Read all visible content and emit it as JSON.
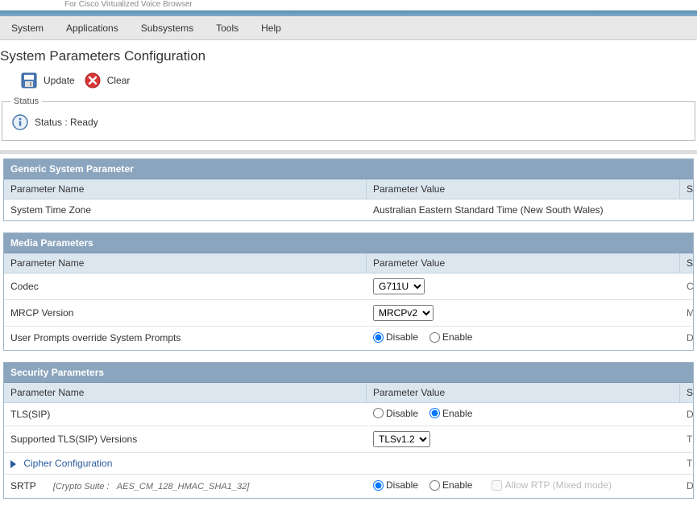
{
  "subtitle": "For Cisco Virtualized Voice Browser",
  "menu": {
    "items": [
      "System",
      "Applications",
      "Subsystems",
      "Tools",
      "Help"
    ]
  },
  "page": {
    "title": "System Parameters Configuration"
  },
  "toolbar": {
    "update_label": "Update",
    "clear_label": "Clear"
  },
  "status": {
    "legend": "Status",
    "text": "Status : Ready"
  },
  "columns": {
    "param_name": "Parameter Name",
    "param_value": "Parameter Value",
    "ext": "S"
  },
  "generic_section": {
    "title": "Generic System Parameter",
    "ext_col": "S",
    "timezone": {
      "name": "System Time Zone",
      "value": "Australian Eastern Standard Time (New South Wales)"
    }
  },
  "media_section": {
    "title": "Media Parameters",
    "ext_col": "S",
    "codec": {
      "name": "Codec",
      "options": [
        "G711U"
      ],
      "selected": "G711U",
      "ext": "C"
    },
    "mrcp": {
      "name": "MRCP Version",
      "options": [
        "MRCPv2"
      ],
      "selected": "MRCPv2",
      "ext": "M"
    },
    "user_prompts": {
      "name": "User Prompts override System Prompts",
      "disable_label": "Disable",
      "enable_label": "Enable",
      "selected": "disable",
      "ext": "D"
    }
  },
  "security_section": {
    "title": "Security Parameters",
    "ext_col": "S",
    "tls_sip": {
      "name": "TLS(SIP)",
      "disable_label": "Disable",
      "enable_label": "Enable",
      "selected": "enable",
      "ext": "D"
    },
    "tls_versions": {
      "name": "Supported TLS(SIP) Versions",
      "options": [
        "TLSv1.2"
      ],
      "selected": "TLSv1.2",
      "ext": "T"
    },
    "cipher": {
      "label": "Cipher Configuration",
      "ext": "T"
    },
    "srtp": {
      "name": "SRTP",
      "crypto_label": "[Crypto Suite :",
      "crypto_value": "AES_CM_128_HMAC_SHA1_32]",
      "disable_label": "Disable",
      "enable_label": "Enable",
      "allow_rtp_label": "Allow RTP (Mixed mode)",
      "selected": "disable",
      "ext": "D"
    }
  }
}
